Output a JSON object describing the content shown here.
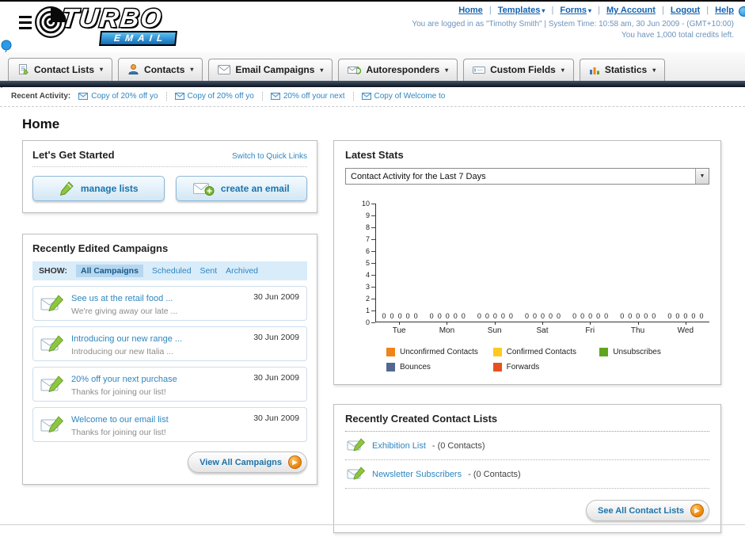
{
  "header": {
    "logo_title": "TURBO",
    "logo_subtitle": "EMAIL",
    "nav_links": [
      "Home",
      "Templates",
      "Forms",
      "My Account",
      "Logout",
      "Help"
    ],
    "login_info": "You are logged in as \"Timothy Smith\" | System Time: 10:58 am, 30 Jun 2009 - (GMT+10:00)",
    "credits_info": "You have 1,000 total credits left."
  },
  "main_nav": {
    "tabs": [
      {
        "label": "Contact Lists"
      },
      {
        "label": "Contacts"
      },
      {
        "label": "Email Campaigns"
      },
      {
        "label": "Autoresponders"
      },
      {
        "label": "Custom Fields"
      },
      {
        "label": "Statistics"
      }
    ]
  },
  "recent_activity": {
    "label": "Recent Activity:",
    "items": [
      "Copy of 20% off yo",
      "Copy of 20% off yo",
      "20% off your next",
      "Copy of Welcome to"
    ]
  },
  "page_title": "Home",
  "get_started": {
    "title": "Let's Get Started",
    "switch_link": "Switch to Quick Links",
    "manage_lists_label": "manage lists",
    "create_email_label": "create an email"
  },
  "campaigns": {
    "title": "Recently Edited Campaigns",
    "show_label": "SHOW:",
    "filters": [
      "All Campaigns",
      "Scheduled",
      "Sent",
      "Archived"
    ],
    "active_filter": "All Campaigns",
    "items": [
      {
        "title": "See us at the retail food ...",
        "subtitle": "We're giving away our late ...",
        "date": "30 Jun 2009"
      },
      {
        "title": "Introducing our new range ...",
        "subtitle": "Introducing our new Italia ...",
        "date": "30 Jun 2009"
      },
      {
        "title": "20% off your next purchase",
        "subtitle": "Thanks for joining our list!",
        "date": "30 Jun 2009"
      },
      {
        "title": "Welcome to our email list",
        "subtitle": "Thanks for joining our list!",
        "date": "30 Jun 2009"
      }
    ],
    "view_all_label": "View All Campaigns"
  },
  "stats": {
    "title": "Latest Stats",
    "dropdown_value": "Contact Activity for the Last 7 Days",
    "chart_data": {
      "type": "bar",
      "title": "Contact Activity for the Last 7 Days",
      "categories": [
        "Tue",
        "Mon",
        "Sun",
        "Sat",
        "Fri",
        "Thu",
        "Wed"
      ],
      "series": [
        {
          "name": "Unconfirmed Contacts",
          "color": "#f08418",
          "values": [
            0,
            0,
            0,
            0,
            0,
            0,
            0
          ]
        },
        {
          "name": "Confirmed Contacts",
          "color": "#ffc91f",
          "values": [
            0,
            0,
            0,
            0,
            0,
            0,
            0
          ]
        },
        {
          "name": "Unsubscribes",
          "color": "#61a51f",
          "values": [
            0,
            0,
            0,
            0,
            0,
            0,
            0
          ]
        },
        {
          "name": "Bounces",
          "color": "#54678f",
          "values": [
            0,
            0,
            0,
            0,
            0,
            0,
            0
          ]
        },
        {
          "name": "Forwards",
          "color": "#e8501f",
          "values": [
            0,
            0,
            0,
            0,
            0,
            0,
            0
          ]
        }
      ],
      "ylim": [
        0,
        10
      ],
      "ytick_step": 1,
      "grid": false,
      "legend_position": "bottom"
    }
  },
  "contact_lists": {
    "title": "Recently Created Contact Lists",
    "items": [
      {
        "name": "Exhibition List",
        "detail": "- (0 Contacts)"
      },
      {
        "name": "Newsletter Subscribers",
        "detail": "- (0 Contacts)"
      }
    ],
    "see_all_label": "See All Contact Lists"
  }
}
